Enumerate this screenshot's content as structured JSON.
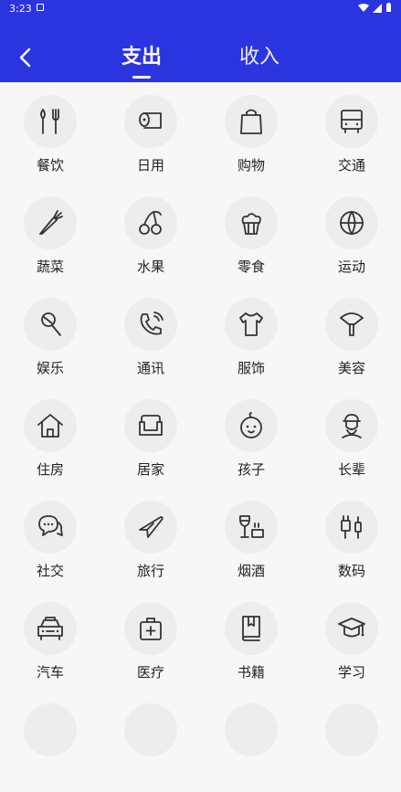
{
  "status": {
    "time": "3:23"
  },
  "tabs": [
    {
      "label": "支出"
    },
    {
      "label": "收入"
    }
  ],
  "categories": [
    {
      "label": "餐饮",
      "icon": "utensils-icon"
    },
    {
      "label": "日用",
      "icon": "tissue-roll-icon"
    },
    {
      "label": "购物",
      "icon": "shopping-bag-icon"
    },
    {
      "label": "交通",
      "icon": "bus-icon"
    },
    {
      "label": "蔬菜",
      "icon": "carrot-icon"
    },
    {
      "label": "水果",
      "icon": "cherry-icon"
    },
    {
      "label": "零食",
      "icon": "cupcake-icon"
    },
    {
      "label": "运动",
      "icon": "basketball-icon"
    },
    {
      "label": "娱乐",
      "icon": "microphone-icon"
    },
    {
      "label": "通讯",
      "icon": "phone-icon"
    },
    {
      "label": "服饰",
      "icon": "tshirt-icon"
    },
    {
      "label": "美容",
      "icon": "fan-brush-icon"
    },
    {
      "label": "住房",
      "icon": "house-icon"
    },
    {
      "label": "居家",
      "icon": "sofa-icon"
    },
    {
      "label": "孩子",
      "icon": "baby-face-icon"
    },
    {
      "label": "长辈",
      "icon": "elder-icon"
    },
    {
      "label": "社交",
      "icon": "chat-bubbles-icon"
    },
    {
      "label": "旅行",
      "icon": "airplane-icon"
    },
    {
      "label": "烟酒",
      "icon": "wine-cigarette-icon"
    },
    {
      "label": "数码",
      "icon": "charger-icon"
    },
    {
      "label": "汽车",
      "icon": "car-icon"
    },
    {
      "label": "医疗",
      "icon": "medical-bag-icon"
    },
    {
      "label": "书籍",
      "icon": "book-icon"
    },
    {
      "label": "学习",
      "icon": "graduation-cap-icon"
    }
  ],
  "colors": {
    "header": "#2a35e0",
    "icon_bg": "#ededed",
    "icon_stroke": "#333333"
  }
}
